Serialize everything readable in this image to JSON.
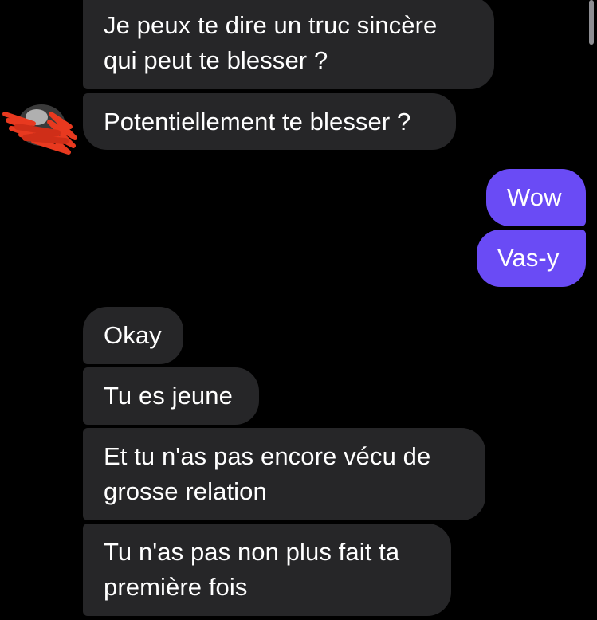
{
  "conversation": {
    "messages": [
      {
        "direction": "received",
        "lines": [
          "Je peux te dire un truc sincère",
          "qui peut te blesser ?"
        ]
      },
      {
        "direction": "received",
        "lines": [
          "Potentiellement te blesser ?"
        ]
      },
      {
        "direction": "sent",
        "lines": [
          "Wow"
        ]
      },
      {
        "direction": "sent",
        "lines": [
          "Vas-y"
        ]
      },
      {
        "direction": "received",
        "lines": [
          "Okay"
        ]
      },
      {
        "direction": "received",
        "lines": [
          "Tu es jeune"
        ]
      },
      {
        "direction": "received",
        "lines": [
          "Et tu n'as pas encore vécu de",
          "grosse relation"
        ]
      },
      {
        "direction": "received",
        "lines": [
          "Tu n'as pas non plus fait ta",
          "première fois"
        ]
      }
    ]
  },
  "colors": {
    "background": "#000000",
    "received_bubble": "#262628",
    "sent_bubble": "#6a4bf5",
    "text": "#ffffff"
  },
  "icons": {
    "avatar": "scribbled-avatar-icon",
    "scrollbar": "scrollbar-thumb"
  }
}
